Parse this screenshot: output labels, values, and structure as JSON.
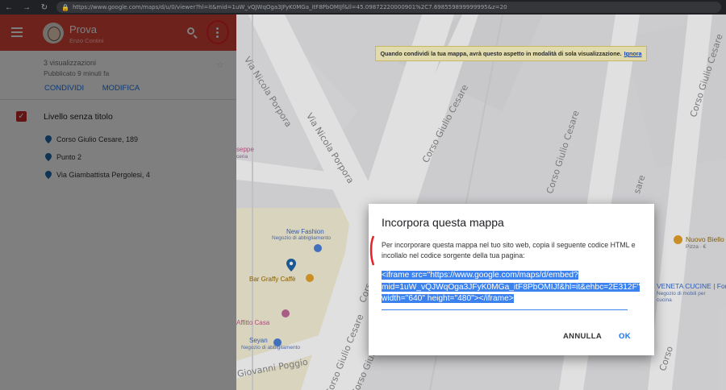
{
  "browser": {
    "url": "https://www.google.com/maps/d/u/0/viewer?hl=it&mid=1uW_vQJWqOga3JFyK0MGa_itF8PbOMIJf&ll=45.09872220000901%2C7.698559899999995&z=20"
  },
  "header": {
    "map_title": "Prova",
    "owner": "Enzo Contini"
  },
  "info": {
    "views": "3 visualizzazioni",
    "updated": "Pubblicato 9 minuti fa"
  },
  "actions": {
    "share_label": "CONDIVIDI",
    "edit_label": "MODIFICA"
  },
  "layer": {
    "title": "Livello senza titolo",
    "features": [
      {
        "label": "Corso Giulio Cesare, 189"
      },
      {
        "label": "Punto 2"
      },
      {
        "label": "Via Giambattista Pergolesi, 4"
      }
    ]
  },
  "banner": {
    "text": "Quando condividi la tua mappa, avrà questo aspetto in modalità di sola visualizzazione.",
    "link": "Ignora"
  },
  "map": {
    "streets": [
      "Via Nicola Porpora",
      "Via Nicola Porpora",
      "Corso Giulio Cesare",
      "Corso Giulio Cesare",
      "Corso Giulio Cesare",
      "Corso Giulio Cesare",
      "Corso Giulio Cesare",
      "Cors",
      "Giovanni Poggio",
      "sare",
      "Corso"
    ],
    "pois": [
      {
        "name": "New Fashion",
        "sub": "Negozio di abbigliamento"
      },
      {
        "name": "Bar Graffy Caffè"
      },
      {
        "name": "Affitto Casa"
      },
      {
        "name": "Seyan",
        "sub": "Negozio di abbigliamento"
      },
      {
        "name": "Nuovo Biello",
        "sub": "Pizza · €"
      },
      {
        "name": "VENETA CUCINE | Fortunato...",
        "sub": "Negozio di mobili per cucina"
      },
      {
        "name": "seppe",
        "sub": "ceria"
      }
    ]
  },
  "dialog": {
    "title": "Incorpora questa mappa",
    "description": "Per incorporare questa mappa nel tuo sito web, copia il seguente codice HTML e incollalo nel codice sorgente della tua pagina:",
    "code": "<iframe src=\"https://www.google.com/maps/d/embed?mid=1uW_vQJWqOga3JFyK0MGa_itF8PbOMIJf&hl=it&ehbc=2E312F\" width=\"640\" height=\"480\"></iframe>",
    "cancel_label": "ANNULLA",
    "ok_label": "OK"
  },
  "colors": {
    "header": "#db4437",
    "accent": "#1a73e8",
    "checkbox": "#c62828",
    "selection": "#3b82ee"
  }
}
